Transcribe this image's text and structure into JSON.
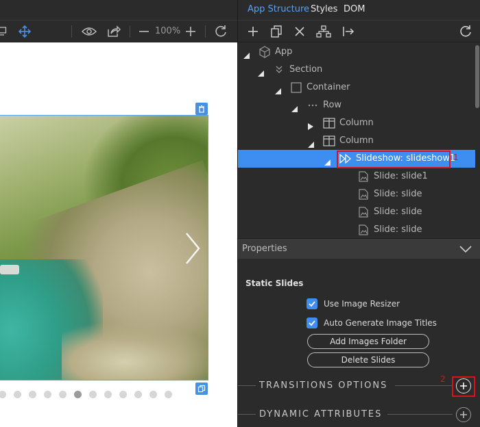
{
  "toolbar": {
    "zoom": "100%"
  },
  "panel": {
    "tabs": [
      {
        "label": "App Structure",
        "active": true
      },
      {
        "label": "Styles",
        "active": false
      },
      {
        "label": "DOM",
        "active": false
      }
    ]
  },
  "tree": {
    "nodes": [
      {
        "label": "App",
        "icon": "cube-icon"
      },
      {
        "label": "Section",
        "icon": "double-chevron-down-icon"
      },
      {
        "label": "Container",
        "icon": "square-icon"
      },
      {
        "label": "Row",
        "icon": "dots-icon"
      },
      {
        "label": "Column",
        "icon": "column-layout-icon"
      },
      {
        "label": "Column",
        "icon": "column-layout-icon"
      },
      {
        "label": "Slideshow: slideshow1",
        "icon": "fast-forward-icon",
        "selected": true
      },
      {
        "label": "Slide: slide1",
        "icon": "image-file-icon"
      },
      {
        "label": "Slide: slide",
        "icon": "image-file-icon"
      },
      {
        "label": "Slide: slide",
        "icon": "image-file-icon"
      },
      {
        "label": "Slide: slide",
        "icon": "image-file-icon"
      }
    ],
    "annotation_1": "1"
  },
  "properties": {
    "title": "Properties",
    "static_slides_title": "Static Slides",
    "use_image_resizer": {
      "label": "Use Image Resizer",
      "checked": true
    },
    "auto_generate_titles": {
      "label": "Auto Generate Image Titles",
      "checked": true
    },
    "add_images_folder": "Add Images Folder",
    "delete_slides": "Delete Slides",
    "transitions_options": "TRANSITIONS OPTIONS",
    "dynamic_attributes": "DYNAMIC ATTRIBUTES",
    "annotation_2": "2"
  },
  "slideshow": {
    "dot_count": 12,
    "active_dot": 5
  },
  "colors": {
    "accent": "#3d8ef0",
    "annotation": "#e0101a",
    "panel_bg": "#2b2b2b"
  }
}
